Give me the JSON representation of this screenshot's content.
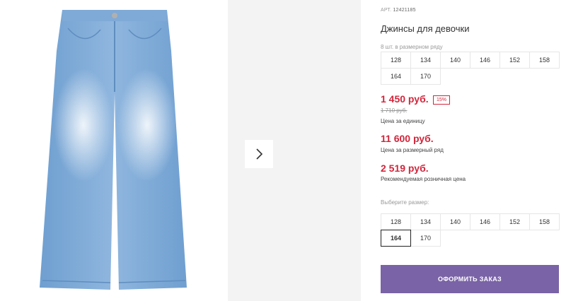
{
  "product": {
    "article_label": "АРТ.",
    "article_number": "12421185",
    "title": "Джинсы для девочки",
    "pieces_in_set": "8 шт. в размерном ряду"
  },
  "size_row": {
    "sizes": [
      "128",
      "134",
      "140",
      "146",
      "152",
      "158",
      "164",
      "170"
    ]
  },
  "pricing": {
    "unit_price": "1 450 руб.",
    "discount_badge": "15%",
    "old_price": "1 710 руб.",
    "unit_caption": "Цена за единицу",
    "set_price": "11 600 руб.",
    "set_caption": "Цена за размерный ряд",
    "retail_price": "2 519 руб.",
    "retail_caption": "Рекомендуемая розничная цена"
  },
  "size_select": {
    "label": "Выберите размер:",
    "options": [
      "128",
      "134",
      "140",
      "146",
      "152",
      "158",
      "164",
      "170"
    ],
    "selected": "164"
  },
  "actions": {
    "order_label": "ОФОРМИТЬ ЗАКАЗ",
    "next_icon": "chevron-right-icon"
  },
  "colors": {
    "accent_price": "#d1263b",
    "order_button": "#7a63a6",
    "gallery_bg": "#f3f3f3"
  }
}
